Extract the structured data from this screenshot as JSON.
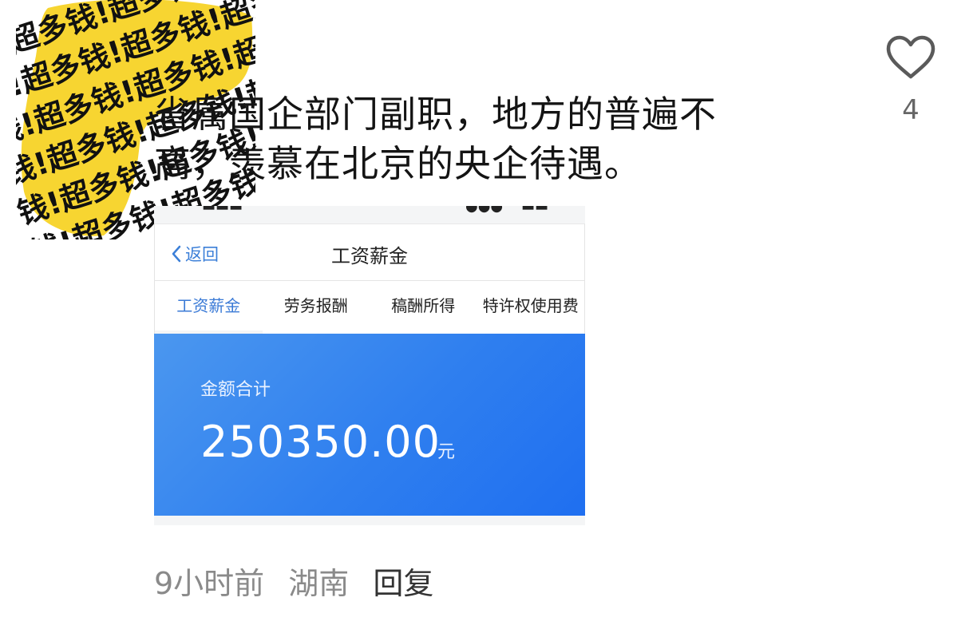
{
  "avatar": {
    "pattern_text": "钱!超多钱!超多钱!超多钱!超多钱!超",
    "color": "#f7d531"
  },
  "comment": {
    "text_line1": "省属国企部门副职，地方的普遍不",
    "text_line2": "高，羡慕在北京的央企待遇。",
    "like_icon": "heart-outline-icon",
    "like_count": "4",
    "time": "9小时前",
    "location": "湖南",
    "reply_label": "回复"
  },
  "screenshot": {
    "nav": {
      "back_label": "返回",
      "title": "工资薪金"
    },
    "tabs": [
      {
        "label": "工资薪金",
        "active": true
      },
      {
        "label": "劳务报酬"
      },
      {
        "label": "稿酬所得"
      },
      {
        "label": "特许权使用费"
      }
    ],
    "summary": {
      "label": "金额合计",
      "amount": "250350.00",
      "unit": "元"
    },
    "accent_color": "#3a7ad6",
    "hero_color": "#2f7fef"
  }
}
